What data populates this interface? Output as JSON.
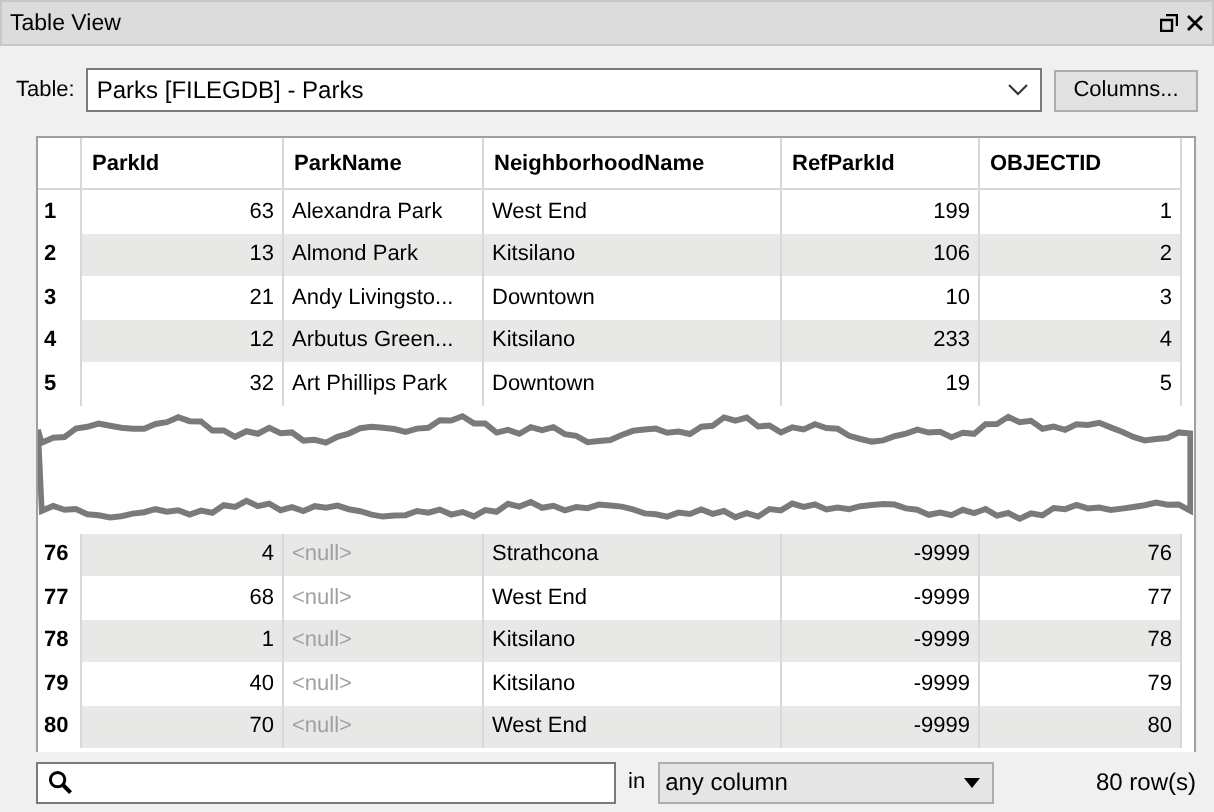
{
  "window": {
    "title": "Table View"
  },
  "table_picker": {
    "label": "Table:",
    "value": "Parks [FILEGDB] - Parks",
    "columns_button": "Columns..."
  },
  "table": {
    "columns": [
      "ParkId",
      "ParkName",
      "NeighborhoodName",
      "RefParkId",
      "OBJECTID"
    ],
    "rows_top": [
      {
        "row": "1",
        "park_id": "63",
        "park_name": "Alexandra Park",
        "park_name_null": false,
        "neighborhood": "West End",
        "ref_park_id": "199",
        "objectid": "1"
      },
      {
        "row": "2",
        "park_id": "13",
        "park_name": "Almond Park",
        "park_name_null": false,
        "neighborhood": "Kitsilano",
        "ref_park_id": "106",
        "objectid": "2"
      },
      {
        "row": "3",
        "park_id": "21",
        "park_name": "Andy Livingsto...",
        "park_name_null": false,
        "neighborhood": "Downtown",
        "ref_park_id": "10",
        "objectid": "3"
      },
      {
        "row": "4",
        "park_id": "12",
        "park_name": "Arbutus Green...",
        "park_name_null": false,
        "neighborhood": "Kitsilano",
        "ref_park_id": "233",
        "objectid": "4"
      },
      {
        "row": "5",
        "park_id": "32",
        "park_name": "Art Phillips Park",
        "park_name_null": false,
        "neighborhood": "Downtown",
        "ref_park_id": "19",
        "objectid": "5"
      }
    ],
    "rows_bottom": [
      {
        "row": "76",
        "park_id": "4",
        "park_name": "<null>",
        "park_name_null": true,
        "neighborhood": "Strathcona",
        "ref_park_id": "-9999",
        "objectid": "76"
      },
      {
        "row": "77",
        "park_id": "68",
        "park_name": "<null>",
        "park_name_null": true,
        "neighborhood": "West End",
        "ref_park_id": "-9999",
        "objectid": "77"
      },
      {
        "row": "78",
        "park_id": "1",
        "park_name": "<null>",
        "park_name_null": true,
        "neighborhood": "Kitsilano",
        "ref_park_id": "-9999",
        "objectid": "78"
      },
      {
        "row": "79",
        "park_id": "40",
        "park_name": "<null>",
        "park_name_null": true,
        "neighborhood": "Kitsilano",
        "ref_park_id": "-9999",
        "objectid": "79"
      },
      {
        "row": "80",
        "park_id": "70",
        "park_name": "<null>",
        "park_name_null": true,
        "neighborhood": "West End",
        "ref_park_id": "-9999",
        "objectid": "80"
      }
    ]
  },
  "search": {
    "in_label": "in",
    "column_filter": "any column",
    "row_count": "80 row(s)"
  }
}
